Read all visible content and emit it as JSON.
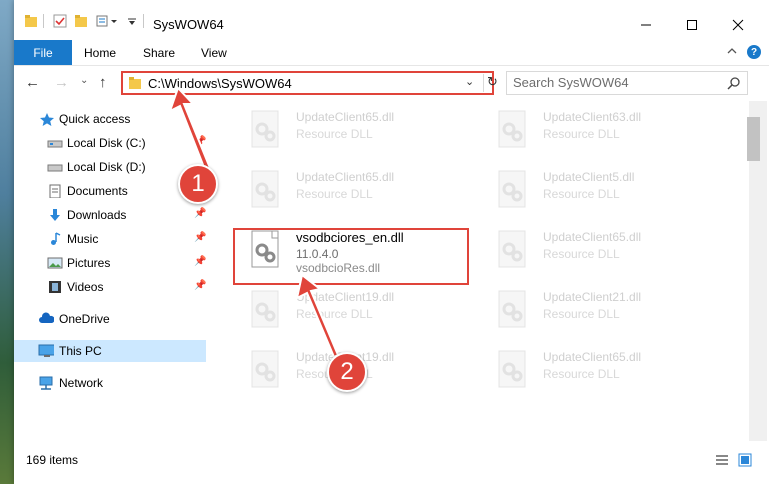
{
  "window": {
    "title": "SysWOW64"
  },
  "ribbon": {
    "tabs": [
      "File",
      "Home",
      "Share",
      "View"
    ]
  },
  "address": {
    "path": "C:\\Windows\\SysWOW64"
  },
  "search": {
    "placeholder": "Search SysWOW64"
  },
  "nav": {
    "items": [
      {
        "label": "Quick access",
        "icon": "star-icon"
      },
      {
        "label": "Local Disk (C:)",
        "icon": "drive-icon",
        "pinned": true
      },
      {
        "label": "Local Disk (D:)",
        "icon": "drive-icon"
      },
      {
        "label": "Documents",
        "icon": "documents-icon"
      },
      {
        "label": "Downloads",
        "icon": "downloads-icon",
        "pinned": true
      },
      {
        "label": "Music",
        "icon": "music-icon",
        "pinned": true
      },
      {
        "label": "Pictures",
        "icon": "pictures-icon",
        "pinned": true
      },
      {
        "label": "Videos",
        "icon": "videos-icon",
        "pinned": true
      },
      {
        "label": "OneDrive",
        "icon": "onedrive-icon"
      },
      {
        "label": "This PC",
        "icon": "this-pc-icon",
        "selected": true
      },
      {
        "label": "Network",
        "icon": "network-icon"
      }
    ]
  },
  "files": {
    "left": [
      {
        "name": "UpdateClient65.dll",
        "desc": "Resource DLL"
      },
      {
        "name": "UpdateClient65.dll",
        "desc": "Resource DLL"
      },
      {
        "name": "vsodbciores_en.dll",
        "desc": "11.0.4.0",
        "desc2": "vsodbcioRes.dll",
        "highlighted": true
      },
      {
        "name": "UpdateClient19.dll",
        "desc": "Resource DLL"
      },
      {
        "name": "UpdateClient19.dll",
        "desc": "Resource DLL"
      }
    ],
    "right": [
      {
        "name": "UpdateClient63.dll",
        "desc": "Resource DLL"
      },
      {
        "name": "UpdateClient5.dll",
        "desc": "Resource DLL"
      },
      {
        "name": "UpdateClient65.dll",
        "desc": "Resource DLL"
      },
      {
        "name": "UpdateClient21.dll",
        "desc": "Resource DLL"
      },
      {
        "name": "UpdateClient65.dll",
        "desc": "Resource DLL"
      }
    ]
  },
  "status": {
    "count": "169 items"
  },
  "annotations": {
    "step1": "1",
    "step2": "2"
  },
  "colors": {
    "accent": "#1979ca",
    "highlight": "#e0443a",
    "selected": "#cce8ff"
  }
}
